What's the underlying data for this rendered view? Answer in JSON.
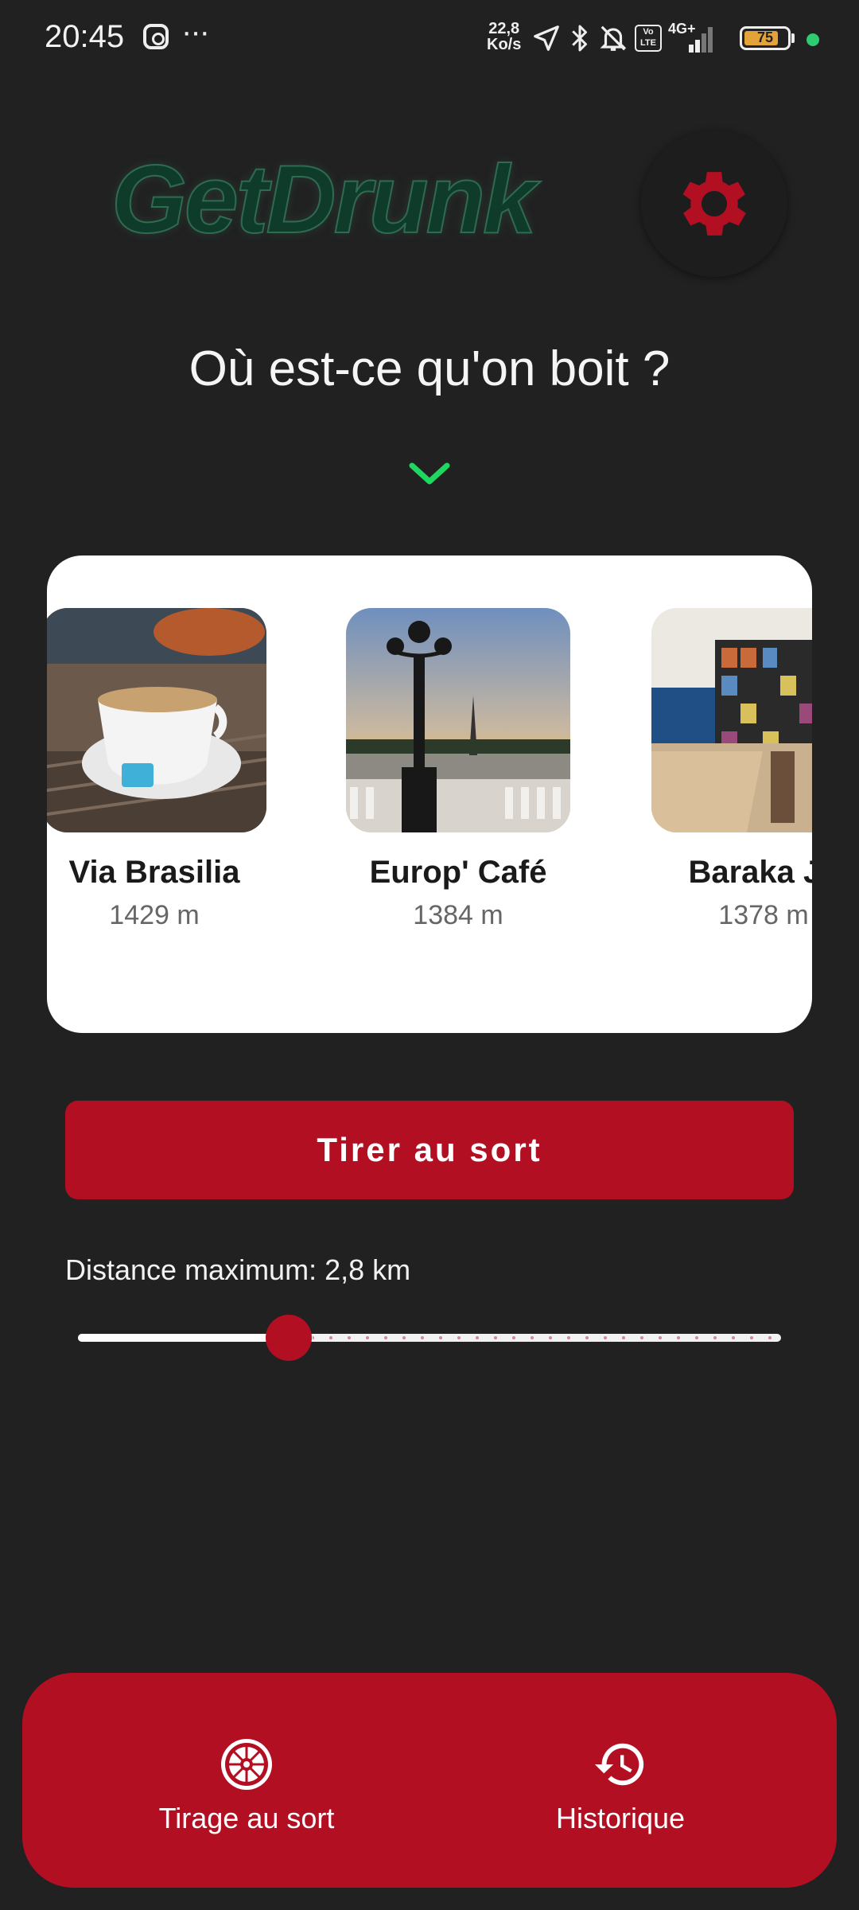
{
  "status_bar": {
    "time": "20:45",
    "speed_value": "22,8",
    "speed_unit": "Ko/s",
    "network": "4G+",
    "volte": "Vo LTE",
    "battery": "75",
    "icons": [
      "instagram-icon",
      "more-icon",
      "location-icon",
      "bluetooth-icon",
      "bell-off-icon",
      "signal-icon",
      "battery-icon"
    ]
  },
  "header": {
    "logo": "GetDrunk",
    "settings_icon": "gear-icon"
  },
  "prompt": {
    "question": "Où est-ce qu'on boit ?",
    "chevron_icon": "chevron-down-icon"
  },
  "places": [
    {
      "name": "Via Brasilia",
      "distance": "1429 m"
    },
    {
      "name": "Europ' Café",
      "distance": "1384 m"
    },
    {
      "name": "Baraka Je",
      "distance": "1378 m"
    }
  ],
  "actions": {
    "draw_label": "Tirer au sort"
  },
  "distance": {
    "label": "Distance maximum: 2,8 km",
    "slider_fraction": 0.3
  },
  "bottom_nav": {
    "items": [
      {
        "label": "Tirage au sort",
        "icon": "roulette-icon"
      },
      {
        "label": "Historique",
        "icon": "history-icon"
      }
    ]
  },
  "colors": {
    "accent": "#b30f22",
    "background": "#212122",
    "chevron": "#1ed760",
    "logo": "#0f3b2a"
  }
}
